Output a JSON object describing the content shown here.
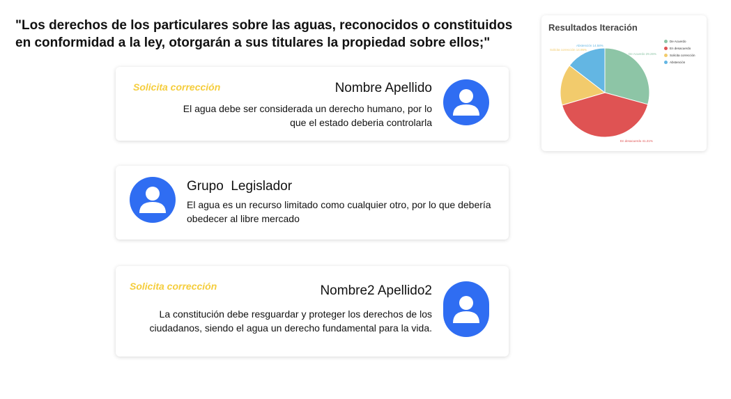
{
  "quote": "\"Los derechos de los particulares sobre las aguas, reconocidos o constituidos en conformidad a la ley, otorgarán a sus titulares la propiedad sobre ellos;\"",
  "comments": [
    {
      "tag": "Solicita corrección",
      "name": "Nombre Apellido",
      "text": "El agua debe ser considerada un derecho humano, por lo que el estado deberia controlarla"
    },
    {
      "name": "Grupo  Legislador",
      "text": "El agua es un recurso limitado como cualquier otro,  por lo que debería  obedecer al libre mercado"
    },
    {
      "tag": "Solicita corrección",
      "name": "Nombre2 Apellido2",
      "text": "La constitución debe resguardar y proteger los derechos de los ciudadanos, siendo el agua un derecho fundamental para la vida."
    }
  ],
  "chart": {
    "title": "Resultados Iteración"
  },
  "chart_data": {
    "type": "pie",
    "title": "Resultados Iteración",
    "legend_position": "top-right",
    "slices": [
      {
        "label": "De Acuerdo",
        "value": 29.26,
        "color": "#8dc5a6",
        "annotation": "De Acuerdo 29.26%"
      },
      {
        "label": "En desacuerdo",
        "value": 41.21,
        "color": "#df5353",
        "annotation": "En desacuerdo 41.21%"
      },
      {
        "label": "Solicita corrección",
        "value": 14.95,
        "color": "#f2cb6c",
        "annotation": "Solicita corrección 14.95%"
      },
      {
        "label": "Abstención",
        "value": 14.58,
        "color": "#63b6e3",
        "annotation": "Abstención 14.58%"
      }
    ]
  },
  "colors": {
    "avatar": "#2f6df2",
    "tag": "#f5cd3c"
  }
}
